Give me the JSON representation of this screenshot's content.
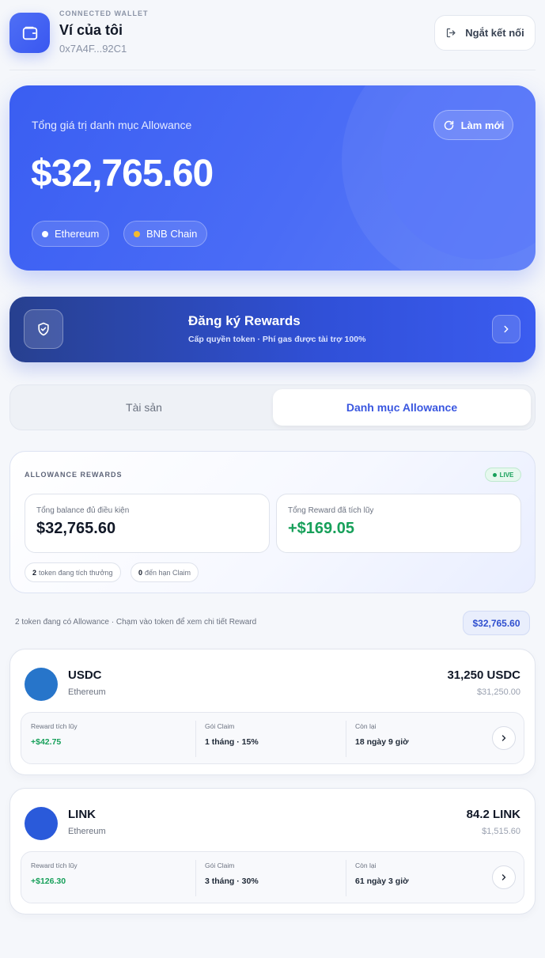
{
  "header": {
    "connected_label": "CONNECTED WALLET",
    "wallet_name": "Ví của tôi",
    "wallet_address": "0x7A4F...92C1",
    "disconnect_label": "Ngắt kết nối"
  },
  "hero": {
    "title": "Tổng giá trị danh mục Allowance",
    "value": "$32,765.60",
    "refresh_label": "Làm mới",
    "chains": [
      {
        "label": "Ethereum",
        "dot_color": "#ffffff"
      },
      {
        "label": "BNB Chain",
        "dot_color": "#f3ba2f"
      }
    ]
  },
  "banner": {
    "title": "Đăng ký Rewards",
    "subtitle": "Cấp quyền token · Phí gas được tài trợ 100%"
  },
  "tabs": [
    {
      "label": "Tài sản",
      "active": false
    },
    {
      "label": "Danh mục Allowance",
      "active": true
    }
  ],
  "summary": {
    "label": "ALLOWANCE REWARDS",
    "live": "LIVE",
    "balance_label": "Tổng balance đủ điều kiện",
    "balance_value": "$32,765.60",
    "reward_label": "Tổng Reward đã tích lũy",
    "reward_value": "+$169.05",
    "chip1_count": "2",
    "chip1_text": "token đang tích thưởng",
    "chip2_count": "0",
    "chip2_text": "đến hạn Claim"
  },
  "list": {
    "hint": "2 token đang có Allowance · Chạm vào token để xem chi tiết Reward",
    "total": "$32,765.60"
  },
  "tokens": [
    {
      "name": "USDC",
      "chain": "Ethereum",
      "amount": "31,250 USDC",
      "usd": "$31,250.00",
      "logo_color": "#2775ca",
      "reward_label": "Reward tích lũy",
      "reward_value": "+$42.75",
      "plan_label": "Gói Claim",
      "plan_value": "1 tháng · 15%",
      "remaining_label": "Còn lại",
      "remaining_value": "18 ngày 9 giờ"
    },
    {
      "name": "LINK",
      "chain": "Ethereum",
      "amount": "84.2 LINK",
      "usd": "$1,515.60",
      "logo_color": "#2a5ada",
      "reward_label": "Reward tích lũy",
      "reward_value": "+$126.30",
      "plan_label": "Gói Claim",
      "plan_value": "3 tháng · 30%",
      "remaining_label": "Còn lại",
      "remaining_value": "61 ngày 3 giờ"
    }
  ]
}
